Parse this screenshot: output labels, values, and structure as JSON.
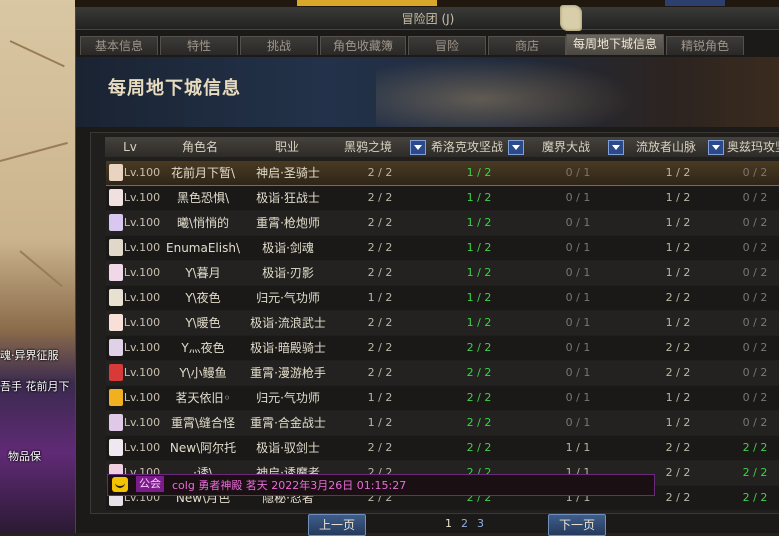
{
  "background": {
    "left_labels": [
      "魂·异界征服",
      "吾手 花前月下",
      "物品保"
    ]
  },
  "window": {
    "title": "冒险团 (J)",
    "tabs": [
      "基本信息",
      "特性",
      "挑战",
      "角色收藏簿",
      "冒险",
      "商店",
      "每周地下城信息",
      "精锐角色"
    ],
    "active_tab": "每周地下城信息"
  },
  "banner": {
    "title": "每周地下城信息"
  },
  "table": {
    "headers": [
      "Lv",
      "角色名",
      "职业",
      "黑鸦之境",
      "希洛克攻坚战",
      "魔界大战",
      "流放者山脉",
      "奥兹玛攻坚"
    ],
    "rows": [
      {
        "lv": "Lv.100",
        "name": "花前月下暂\\",
        "job": "神启·圣骑士",
        "c1": "2 / 2",
        "c2": "1 / 2",
        "c3": "0 / 1",
        "c4": "1 / 2",
        "c5": "0 / 2"
      },
      {
        "lv": "Lv.100",
        "name": "黑色恐惧\\",
        "job": "极诣·狂战士",
        "c1": "2 / 2",
        "c2": "1 / 2",
        "c3": "0 / 1",
        "c4": "1 / 2",
        "c5": "0 / 2"
      },
      {
        "lv": "Lv.100",
        "name": "曦\\悄悄的",
        "job": "重霄·枪炮师",
        "c1": "2 / 2",
        "c2": "1 / 2",
        "c3": "0 / 1",
        "c4": "1 / 2",
        "c5": "0 / 2"
      },
      {
        "lv": "Lv.100",
        "name": "EnumaElish\\",
        "job": "极诣·剑魂",
        "c1": "2 / 2",
        "c2": "1 / 2",
        "c3": "0 / 1",
        "c4": "1 / 2",
        "c5": "0 / 2"
      },
      {
        "lv": "Lv.100",
        "name": "Y\\暮月",
        "job": "极诣·刃影",
        "c1": "2 / 2",
        "c2": "1 / 2",
        "c3": "0 / 1",
        "c4": "1 / 2",
        "c5": "0 / 2"
      },
      {
        "lv": "Lv.100",
        "name": "Y\\夜色",
        "job": "归元·气功师",
        "c1": "1 / 2",
        "c2": "1 / 2",
        "c3": "0 / 1",
        "c4": "2 / 2",
        "c5": "0 / 2"
      },
      {
        "lv": "Lv.100",
        "name": "Y\\暖色",
        "job": "极诣·流浪武士",
        "c1": "2 / 2",
        "c2": "1 / 2",
        "c3": "0 / 1",
        "c4": "1 / 2",
        "c5": "0 / 2"
      },
      {
        "lv": "Lv.100",
        "name": "Y灬夜色",
        "job": "极诣·暗殿骑士",
        "c1": "2 / 2",
        "c2": "2 / 2",
        "c3": "0 / 1",
        "c4": "2 / 2",
        "c5": "0 / 2"
      },
      {
        "lv": "Lv.100",
        "name": "Y\\小鳗鱼",
        "job": "重霄·漫游枪手",
        "c1": "2 / 2",
        "c2": "2 / 2",
        "c3": "0 / 1",
        "c4": "2 / 2",
        "c5": "0 / 2"
      },
      {
        "lv": "Lv.100",
        "name": "茗天依旧◦",
        "job": "归元·气功师",
        "c1": "1 / 2",
        "c2": "2 / 2",
        "c3": "0 / 1",
        "c4": "1 / 2",
        "c5": "0 / 2"
      },
      {
        "lv": "Lv.100",
        "name": "重霄\\缝合怪",
        "job": "重霄·合金战士",
        "c1": "1 / 2",
        "c2": "2 / 2",
        "c3": "0 / 1",
        "c4": "1 / 2",
        "c5": "0 / 2"
      },
      {
        "lv": "Lv.100",
        "name": "New\\阿尔托",
        "job": "极诣·驭剑士",
        "c1": "2 / 2",
        "c2": "2 / 2",
        "c3": "1 / 1",
        "c4": "2 / 2",
        "c5": "2 / 2"
      },
      {
        "lv": "Lv.100",
        "name": "·诱\\",
        "job": "神启·诱魔者",
        "c1": "2 / 2",
        "c2": "2 / 2",
        "c3": "1 / 1",
        "c4": "2 / 2",
        "c5": "2 / 2"
      },
      {
        "lv": "Lv.100",
        "name": "New\\月色",
        "job": "隐秘·忍者",
        "c1": "2 / 2",
        "c2": "2 / 2",
        "c3": "1 / 1",
        "c4": "2 / 2",
        "c5": "2 / 2"
      }
    ]
  },
  "chat": {
    "channel": "公会",
    "message": "colg  勇者神殿  茗天  2022年3月26日  01:15:27"
  },
  "pager": {
    "prev": "上一页",
    "next": "下一页",
    "pages": [
      "1",
      "2",
      "3"
    ],
    "current": "1"
  },
  "colors": {
    "complete": "#3fd24a",
    "incomplete": "#7c776f",
    "chat": "#e96bd8",
    "selected_row": "#4a3a22"
  }
}
